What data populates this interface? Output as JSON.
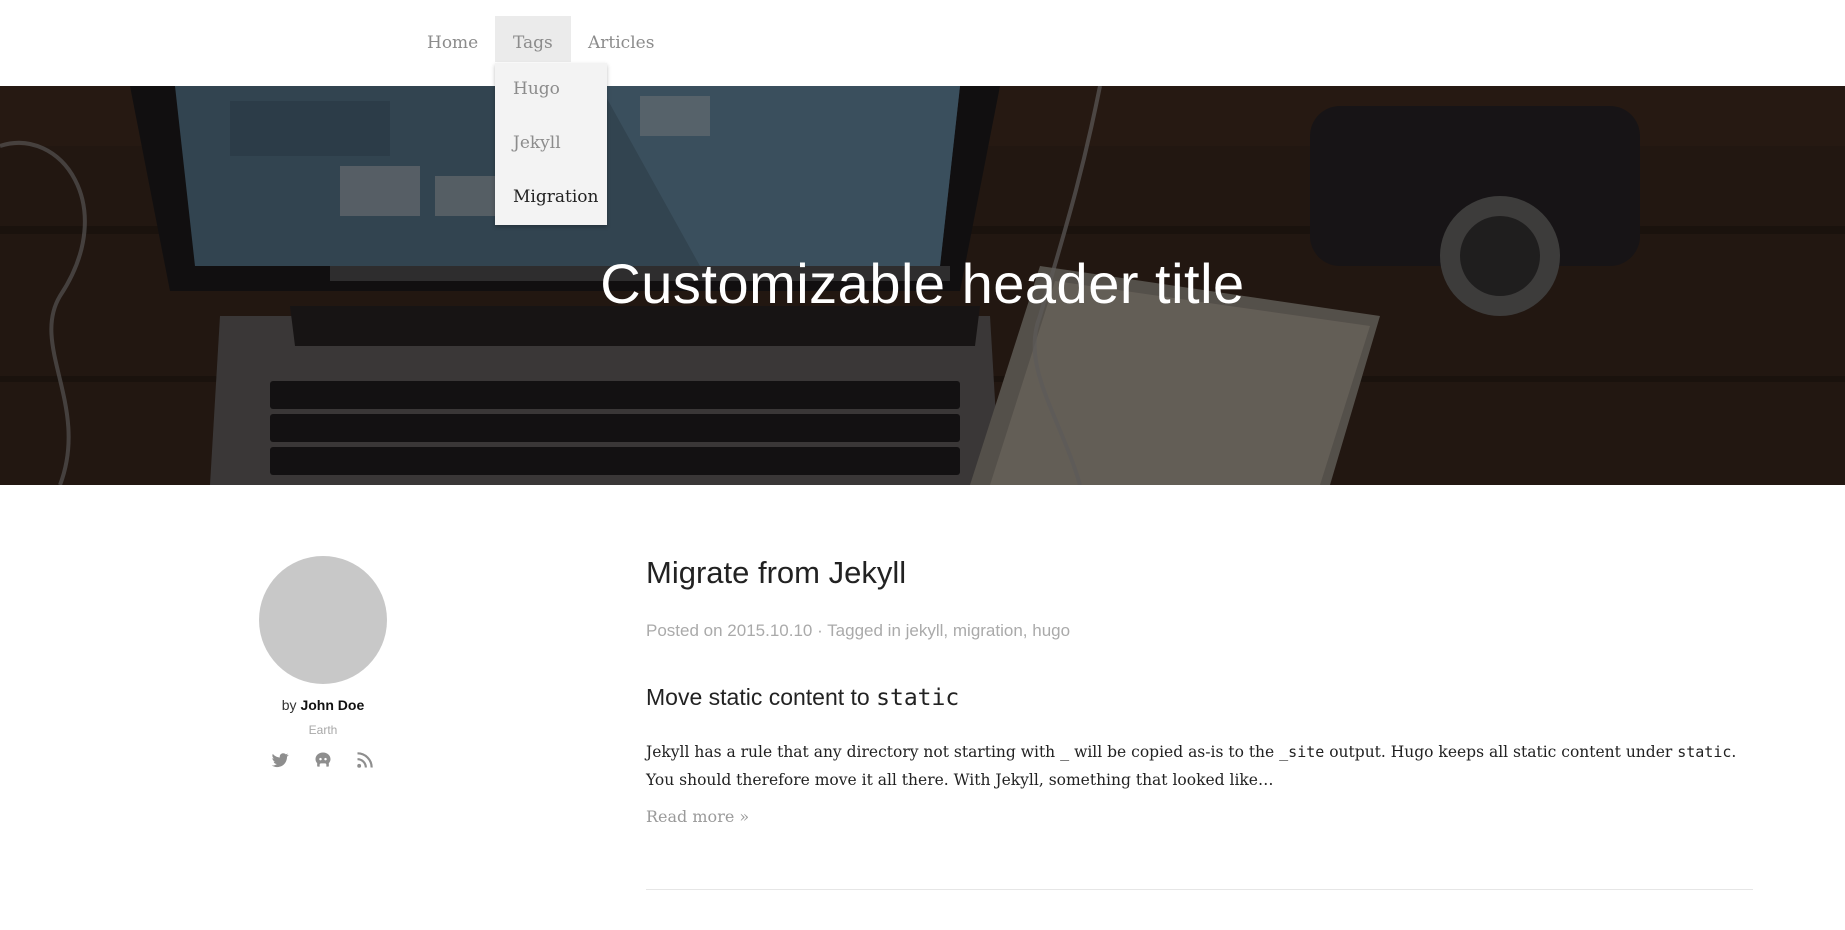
{
  "nav": {
    "items": [
      {
        "label": "Home"
      },
      {
        "label": "Tags"
      },
      {
        "label": "Articles"
      }
    ],
    "tags_dropdown": [
      {
        "label": "Hugo"
      },
      {
        "label": "Jekyll"
      },
      {
        "label": "Migration",
        "active": true
      }
    ]
  },
  "hero": {
    "title": "Customizable header title"
  },
  "sidebar": {
    "by_prefix": "by",
    "author": "John Doe",
    "location": "Earth",
    "socials": [
      "twitter-icon",
      "github-icon",
      "rss-icon"
    ]
  },
  "post": {
    "title": "Migrate from Jekyll",
    "meta_posted": "Posted on 2015.10.10 · Tagged in ",
    "tags": [
      "jekyll",
      "migration",
      "hugo"
    ],
    "subheading_text": "Move static content to ",
    "subheading_code": "static",
    "body": {
      "part1": "Jekyll has a rule that any directory not starting with ",
      "code1": "_",
      "part2": " will be copied as-is to the ",
      "code2": "_site",
      "part3": " output. Hugo keeps all static content under ",
      "code3": "static",
      "part4": ". You should therefore move it all there. With Jekyll, something that looked like…"
    },
    "read_more": "Read more »"
  }
}
